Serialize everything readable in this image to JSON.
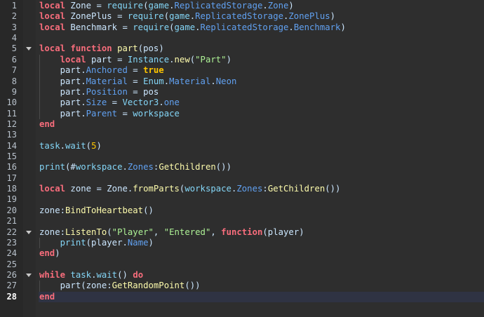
{
  "editor": {
    "current_line": 28,
    "colors": {
      "keyword": "#f86d7c",
      "builtin": "#84d6f7",
      "method": "#fdfbac",
      "property": "#61a1f1",
      "bool": "#ffc600",
      "string": "#adf195",
      "identifier": "#cce7ff"
    },
    "lines": [
      {
        "n": "1",
        "fold": false,
        "guide": false,
        "t": [
          [
            "kw",
            "local"
          ],
          [
            "id",
            " Zone = "
          ],
          [
            "bi",
            "require"
          ],
          [
            "id",
            "("
          ],
          [
            "bi",
            "game"
          ],
          [
            "id",
            "."
          ],
          [
            "pr",
            "ReplicatedStorage"
          ],
          [
            "id",
            "."
          ],
          [
            "pr",
            "Zone"
          ],
          [
            "id",
            ")"
          ]
        ]
      },
      {
        "n": "2",
        "fold": false,
        "guide": false,
        "t": [
          [
            "kw",
            "local"
          ],
          [
            "id",
            " ZonePlus = "
          ],
          [
            "bi",
            "require"
          ],
          [
            "id",
            "("
          ],
          [
            "bi",
            "game"
          ],
          [
            "id",
            "."
          ],
          [
            "pr",
            "ReplicatedStorage"
          ],
          [
            "id",
            "."
          ],
          [
            "pr",
            "ZonePlus"
          ],
          [
            "id",
            ")"
          ]
        ]
      },
      {
        "n": "3",
        "fold": false,
        "guide": false,
        "t": [
          [
            "kw",
            "local"
          ],
          [
            "id",
            " Benchmark = "
          ],
          [
            "bi",
            "require"
          ],
          [
            "id",
            "("
          ],
          [
            "bi",
            "game"
          ],
          [
            "id",
            "."
          ],
          [
            "pr",
            "ReplicatedStorage"
          ],
          [
            "id",
            "."
          ],
          [
            "pr",
            "Benchmark"
          ],
          [
            "id",
            ")"
          ]
        ]
      },
      {
        "n": "4",
        "fold": false,
        "guide": false,
        "t": []
      },
      {
        "n": "5",
        "fold": true,
        "guide": false,
        "t": [
          [
            "kw",
            "local"
          ],
          [
            "id",
            " "
          ],
          [
            "kw",
            "function"
          ],
          [
            "id",
            " "
          ],
          [
            "fn",
            "part"
          ],
          [
            "id",
            "(pos)"
          ]
        ]
      },
      {
        "n": "6",
        "fold": false,
        "guide": true,
        "t": [
          [
            "id",
            "    "
          ],
          [
            "kw",
            "local"
          ],
          [
            "id",
            " part = "
          ],
          [
            "bi",
            "Instance"
          ],
          [
            "id",
            "."
          ],
          [
            "fn",
            "new"
          ],
          [
            "id",
            "("
          ],
          [
            "st",
            "\"Part\""
          ],
          [
            "id",
            ")"
          ]
        ]
      },
      {
        "n": "7",
        "fold": false,
        "guide": true,
        "t": [
          [
            "id",
            "    part."
          ],
          [
            "pr",
            "Anchored"
          ],
          [
            "id",
            " = "
          ],
          [
            "bo",
            "true"
          ]
        ]
      },
      {
        "n": "8",
        "fold": false,
        "guide": true,
        "t": [
          [
            "id",
            "    part."
          ],
          [
            "pr",
            "Material"
          ],
          [
            "id",
            " = "
          ],
          [
            "bi",
            "Enum"
          ],
          [
            "id",
            "."
          ],
          [
            "pr",
            "Material"
          ],
          [
            "id",
            "."
          ],
          [
            "pr",
            "Neon"
          ]
        ]
      },
      {
        "n": "9",
        "fold": false,
        "guide": true,
        "t": [
          [
            "id",
            "    part."
          ],
          [
            "pr",
            "Position"
          ],
          [
            "id",
            " = pos"
          ]
        ]
      },
      {
        "n": "10",
        "fold": false,
        "guide": true,
        "t": [
          [
            "id",
            "    part."
          ],
          [
            "pr",
            "Size"
          ],
          [
            "id",
            " = "
          ],
          [
            "bi",
            "Vector3"
          ],
          [
            "id",
            "."
          ],
          [
            "pr",
            "one"
          ]
        ]
      },
      {
        "n": "11",
        "fold": false,
        "guide": true,
        "t": [
          [
            "id",
            "    part."
          ],
          [
            "pr",
            "Parent"
          ],
          [
            "id",
            " = "
          ],
          [
            "bi",
            "workspace"
          ]
        ]
      },
      {
        "n": "12",
        "fold": false,
        "guide": false,
        "t": [
          [
            "kw",
            "end"
          ]
        ]
      },
      {
        "n": "13",
        "fold": false,
        "guide": false,
        "t": []
      },
      {
        "n": "14",
        "fold": false,
        "guide": false,
        "t": [
          [
            "bi",
            "task"
          ],
          [
            "id",
            "."
          ],
          [
            "bi",
            "wait"
          ],
          [
            "id",
            "("
          ],
          [
            "nu",
            "5"
          ],
          [
            "id",
            ")"
          ]
        ]
      },
      {
        "n": "15",
        "fold": false,
        "guide": false,
        "t": []
      },
      {
        "n": "16",
        "fold": false,
        "guide": false,
        "t": [
          [
            "bi",
            "print"
          ],
          [
            "id",
            "(#"
          ],
          [
            "bi",
            "workspace"
          ],
          [
            "id",
            "."
          ],
          [
            "pr",
            "Zones"
          ],
          [
            "id",
            ":"
          ],
          [
            "fn",
            "GetChildren"
          ],
          [
            "id",
            "())"
          ]
        ]
      },
      {
        "n": "17",
        "fold": false,
        "guide": false,
        "t": []
      },
      {
        "n": "18",
        "fold": false,
        "guide": false,
        "t": [
          [
            "kw",
            "local"
          ],
          [
            "id",
            " zone = Zone."
          ],
          [
            "fn",
            "fromParts"
          ],
          [
            "id",
            "("
          ],
          [
            "bi",
            "workspace"
          ],
          [
            "id",
            "."
          ],
          [
            "pr",
            "Zones"
          ],
          [
            "id",
            ":"
          ],
          [
            "fn",
            "GetChildren"
          ],
          [
            "id",
            "())"
          ]
        ]
      },
      {
        "n": "19",
        "fold": false,
        "guide": false,
        "t": []
      },
      {
        "n": "20",
        "fold": false,
        "guide": false,
        "t": [
          [
            "id",
            "zone:"
          ],
          [
            "fn",
            "BindToHeartbeat"
          ],
          [
            "id",
            "()"
          ]
        ]
      },
      {
        "n": "21",
        "fold": false,
        "guide": false,
        "t": []
      },
      {
        "n": "22",
        "fold": true,
        "guide": false,
        "t": [
          [
            "id",
            "zone:"
          ],
          [
            "fn",
            "ListenTo"
          ],
          [
            "id",
            "("
          ],
          [
            "st",
            "\"Player\""
          ],
          [
            "id",
            ", "
          ],
          [
            "st",
            "\"Entered\""
          ],
          [
            "id",
            ", "
          ],
          [
            "kw",
            "function"
          ],
          [
            "id",
            "(player)"
          ]
        ]
      },
      {
        "n": "23",
        "fold": false,
        "guide": true,
        "t": [
          [
            "id",
            "    "
          ],
          [
            "bi",
            "print"
          ],
          [
            "id",
            "(player."
          ],
          [
            "pr",
            "Name"
          ],
          [
            "id",
            ")"
          ]
        ]
      },
      {
        "n": "24",
        "fold": false,
        "guide": false,
        "t": [
          [
            "kw",
            "end"
          ],
          [
            "id",
            ")"
          ]
        ]
      },
      {
        "n": "25",
        "fold": false,
        "guide": false,
        "t": []
      },
      {
        "n": "26",
        "fold": true,
        "guide": false,
        "t": [
          [
            "kw",
            "while"
          ],
          [
            "id",
            " "
          ],
          [
            "bi",
            "task"
          ],
          [
            "id",
            "."
          ],
          [
            "bi",
            "wait"
          ],
          [
            "id",
            "() "
          ],
          [
            "kw",
            "do"
          ]
        ]
      },
      {
        "n": "27",
        "fold": false,
        "guide": true,
        "t": [
          [
            "id",
            "    part(zone:"
          ],
          [
            "fn",
            "GetRandomPoint"
          ],
          [
            "id",
            "())"
          ]
        ]
      },
      {
        "n": "28",
        "fold": false,
        "guide": false,
        "t": [
          [
            "kw",
            "end"
          ]
        ]
      }
    ]
  }
}
